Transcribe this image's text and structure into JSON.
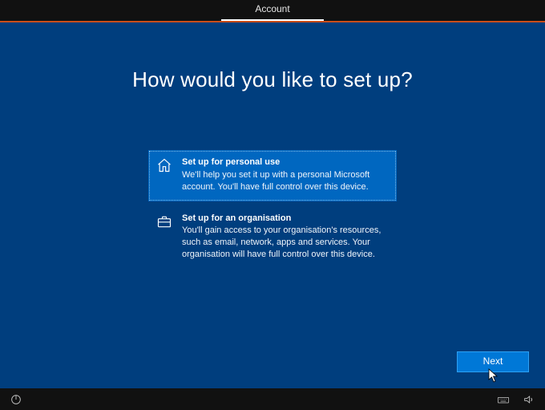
{
  "topbar": {
    "tab": "Account"
  },
  "headline": "How would you like to set up?",
  "options": {
    "personal": {
      "title": "Set up for personal use",
      "desc": "We'll help you set it up with a personal Microsoft account. You'll have full control over this device.",
      "selected": true
    },
    "org": {
      "title": "Set up for an organisation",
      "desc": "You'll gain access to your organisation's resources, such as email, network, apps and services. Your organisation will have full control over this device.",
      "selected": false
    }
  },
  "buttons": {
    "next": "Next"
  },
  "colors": {
    "accent": "#0078d7",
    "bg": "#003e7e",
    "topline": "#cb4e1a"
  }
}
